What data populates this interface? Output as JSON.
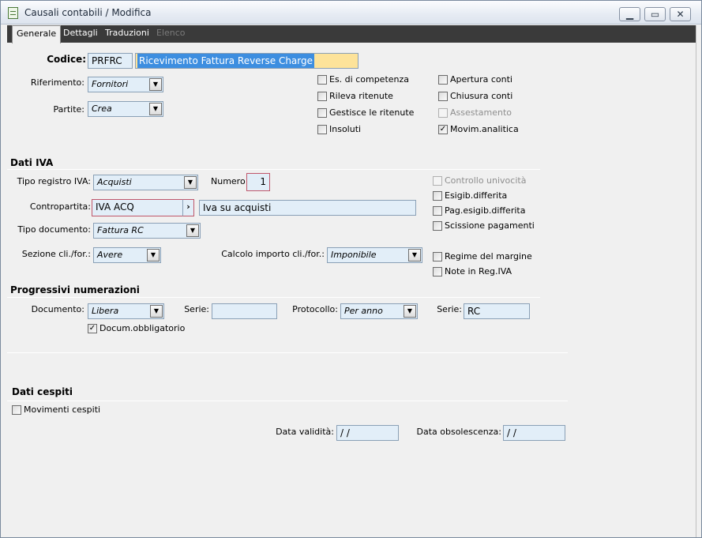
{
  "window": {
    "title": "Causali contabili / Modifica",
    "minimize": "▁",
    "maximize": "▭",
    "close": "✕"
  },
  "tabs": [
    {
      "label": "Generale"
    },
    {
      "label": "Dettagli"
    },
    {
      "label": "Traduzioni"
    },
    {
      "label": "Elenco"
    }
  ],
  "header": {
    "codice_label": "Codice:",
    "codice_value": "PRFRC",
    "descrizione_value": "Ricevimento Fattura Reverse Charge",
    "riferimento_label": "Riferimento:",
    "riferimento_value": "Fornitori",
    "partite_label": "Partite:",
    "partite_value": "Crea"
  },
  "flags": {
    "es_competenza": "Es. di competenza",
    "rileva_ritenute": "Rileva ritenute",
    "gestisce_ritenute": "Gestisce le ritenute",
    "insoluti": "Insoluti",
    "apertura_conti": "Apertura conti",
    "chiusura_conti": "Chiusura conti",
    "assestamento": "Assestamento",
    "movim_analitica": "Movim.analitica",
    "movim_analitica_checked": "✓"
  },
  "iva": {
    "section_title": "Dati IVA",
    "tipo_registro_label": "Tipo registro IVA:",
    "tipo_registro_value": "Acquisti",
    "numero_label": "Numero:",
    "numero_value": "1",
    "contropartita_label": "Contropartita:",
    "contropartita_code": "IVA ACQ",
    "contropartita_zoom": "›",
    "contropartita_desc": "Iva su acquisti",
    "tipo_documento_label": "Tipo documento:",
    "tipo_documento_value": "Fattura RC",
    "sezione_label": "Sezione cli./for.:",
    "sezione_value": "Avere",
    "calcolo_label": "Calcolo importo cli./for.:",
    "calcolo_value": "Imponibile",
    "controllo_univocita": "Controllo univocità",
    "esigib_differita": "Esigib.differita",
    "pag_esigib_differita": "Pag.esigib.differita",
    "scissione_pagamenti": "Scissione pagamenti",
    "regime_margine": "Regime del margine",
    "note_reg_iva": "Note in Reg.IVA"
  },
  "progressivi": {
    "section_title": "Progressivi numerazioni",
    "documento_label": "Documento:",
    "documento_value": "Libera",
    "serie_label": "Serie:",
    "serie_value": "",
    "protocollo_label": "Protocollo:",
    "protocollo_value": "Per anno",
    "serie2_label": "Serie:",
    "serie2_value": "RC",
    "docum_obbligatorio": "Docum.obbligatorio",
    "docum_obbligatorio_checked": "✓"
  },
  "cespiti": {
    "section_title": "Dati cespiti",
    "movimenti_cespiti": "Movimenti cespiti",
    "data_validita_label": "Data validità:",
    "data_validita_value": " /  /",
    "data_obsolescenza_label": "Data obsolescenza:",
    "data_obsolescenza_value": " /  /"
  },
  "icons": {
    "combo_arrow": "▼"
  }
}
